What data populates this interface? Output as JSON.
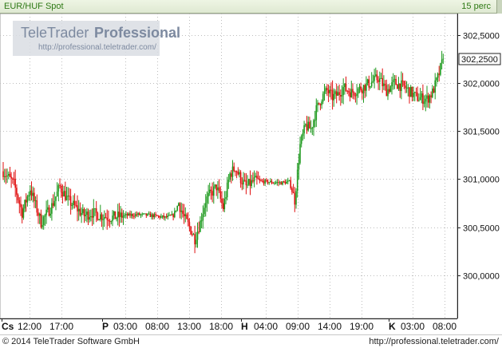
{
  "header": {
    "symbol": "EUR/HUF Spot",
    "interval": "15 perc"
  },
  "watermark": {
    "brand_light": "TeleTrader",
    "brand_bold": "Professional",
    "url": "http://professional.teletrader.com/"
  },
  "footer": {
    "copyright": "© 2014  TeleTrader Software GmbH",
    "url": "http://professional.teletrader.com/"
  },
  "colors": {
    "up": "#1f9a1f",
    "down": "#e01010",
    "neutral": "#222222",
    "grid": "#bdbdbd",
    "last_price_box": "#ffffff"
  },
  "chart_data": {
    "type": "candlestick",
    "title": "EUR/HUF Spot",
    "interval": "15 perc",
    "last_price": 302.25,
    "last_price_label": "302,2500",
    "ylim": [
      299.55,
      302.72
    ],
    "y_ticks": [
      {
        "value": 300.0,
        "label": "300,0000"
      },
      {
        "value": 300.5,
        "label": "300,5000"
      },
      {
        "value": 301.0,
        "label": "301,0000"
      },
      {
        "value": 301.5,
        "label": "301,5000"
      },
      {
        "value": 302.0,
        "label": "302,0000"
      },
      {
        "value": 302.5,
        "label": "302,5000"
      }
    ],
    "x_ticks": [
      {
        "label": "Cs",
        "bold": true
      },
      {
        "label": "12:00"
      },
      {
        "label": "17:00"
      },
      {
        "label": "P",
        "bold": true
      },
      {
        "label": "03:00"
      },
      {
        "label": "08:00"
      },
      {
        "label": "13:00"
      },
      {
        "label": "18:00"
      },
      {
        "label": "H",
        "bold": true
      },
      {
        "label": "04:00"
      },
      {
        "label": "09:00"
      },
      {
        "label": "14:00"
      },
      {
        "label": "19:00"
      },
      {
        "label": "K",
        "bold": true
      },
      {
        "label": "03:00"
      },
      {
        "label": "08:00"
      }
    ],
    "grid": true,
    "price_path": [
      [
        0,
        301.08
      ],
      [
        8,
        300.95
      ],
      [
        14,
        300.65
      ],
      [
        20,
        300.9
      ],
      [
        28,
        300.55
      ],
      [
        36,
        300.72
      ],
      [
        42,
        300.92
      ],
      [
        48,
        300.78
      ],
      [
        54,
        300.7
      ],
      [
        60,
        300.62
      ],
      [
        66,
        300.65
      ],
      [
        72,
        300.62
      ],
      [
        80,
        300.6
      ],
      [
        90,
        300.62
      ],
      [
        100,
        300.63
      ],
      [
        110,
        300.62
      ],
      [
        120,
        300.6
      ],
      [
        126,
        300.62
      ],
      [
        130,
        300.75
      ],
      [
        134,
        300.6
      ],
      [
        138,
        300.5
      ],
      [
        142,
        300.38
      ],
      [
        146,
        300.55
      ],
      [
        150,
        300.78
      ],
      [
        154,
        300.85
      ],
      [
        158,
        300.92
      ],
      [
        163,
        300.7
      ],
      [
        168,
        301.05
      ],
      [
        172,
        301.12
      ],
      [
        176,
        301.0
      ],
      [
        180,
        300.92
      ],
      [
        186,
        300.98
      ],
      [
        196,
        300.97
      ],
      [
        206,
        300.96
      ],
      [
        212,
        300.97
      ],
      [
        216,
        300.78
      ],
      [
        220,
        301.35
      ],
      [
        224,
        301.55
      ],
      [
        228,
        301.52
      ],
      [
        232,
        301.72
      ],
      [
        236,
        301.85
      ],
      [
        240,
        301.92
      ],
      [
        244,
        301.85
      ],
      [
        248,
        301.88
      ],
      [
        252,
        301.95
      ],
      [
        258,
        301.9
      ],
      [
        266,
        301.95
      ],
      [
        272,
        302.0
      ],
      [
        278,
        302.05
      ],
      [
        284,
        301.92
      ],
      [
        290,
        302.0
      ],
      [
        298,
        301.95
      ],
      [
        306,
        301.85
      ],
      [
        314,
        301.83
      ],
      [
        318,
        301.9
      ],
      [
        322,
        302.05
      ],
      [
        326,
        302.25
      ]
    ],
    "n_bars": 327
  }
}
